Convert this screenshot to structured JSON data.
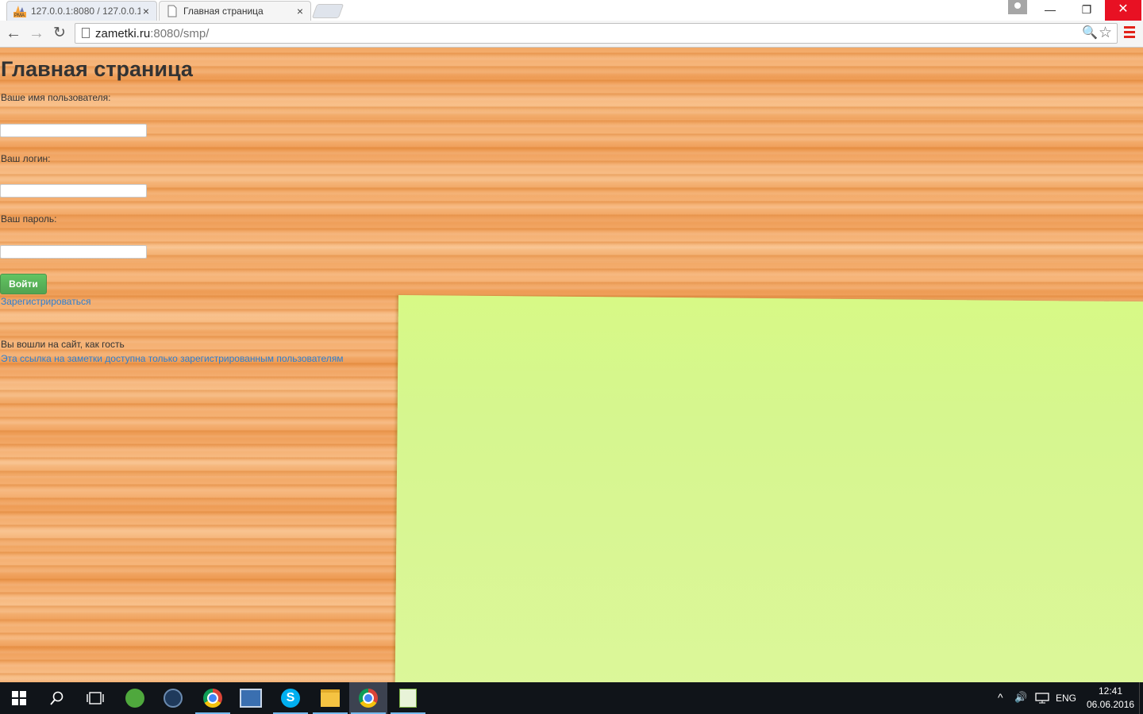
{
  "browser": {
    "tabs": [
      {
        "title": "127.0.0.1:8080 / 127.0.0.1",
        "favicon": "phpmyadmin-icon",
        "active": false
      },
      {
        "title": "Главная страница",
        "favicon": "page-icon",
        "active": true
      }
    ],
    "window_controls": {
      "minimize": "—",
      "maximize": "❐",
      "close": "✕"
    },
    "nav": {
      "back": "←",
      "forward": "→",
      "reload": "↻"
    },
    "address": {
      "host": "zametki.ru",
      "rest": ":8080/smp/"
    },
    "icons": {
      "zoom": "🔍",
      "star": "☆"
    }
  },
  "page": {
    "title": "Главная страница",
    "username_label": "Ваше имя пользователя:",
    "login_label": "Ваш логин:",
    "password_label": "Ваш пароль:",
    "username_value": "",
    "login_value": "",
    "password_value": "",
    "submit_label": "Войти",
    "register_link": "Зарегистрироваться",
    "guest_status": "Вы вошли на сайт, как гость",
    "notes_link": "Эта ссылка на заметки доступна только зарегистрированным пользователям"
  },
  "taskbar": {
    "apps": [
      "start-icon",
      "search-icon",
      "task-view-icon",
      "utorrent-icon",
      "steam-icon",
      "chrome-icon",
      "remote-desktop-icon",
      "skype-icon",
      "file-explorer-icon",
      "chrome-icon",
      "notepad-plus-icon"
    ],
    "tray": {
      "language": "ENG",
      "time": "12:41",
      "date": "06.06.2016",
      "chevron": "^",
      "volume": "🔊"
    }
  }
}
